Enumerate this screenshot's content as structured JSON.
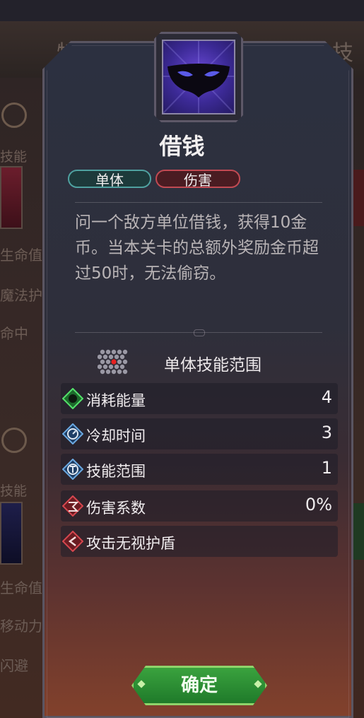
{
  "background": {
    "tabs": [
      "特厍",
      "技俞"
    ],
    "side_labels": [
      "技能",
      "生命值",
      "魔法护",
      "命中",
      "技能",
      "生命值",
      "移动力",
      "闪避"
    ]
  },
  "skill": {
    "name": "借钱",
    "icon": "mask-icon",
    "tags": [
      "单体",
      "伤害"
    ],
    "description": "问一个敌方单位借钱，获得10金币。当本关卡的总额外奖励金币超过50时，无法偷窃。",
    "range_label": "单体技能范围"
  },
  "stats": [
    {
      "icon": "energy-icon",
      "label": "消耗能量",
      "value": "4"
    },
    {
      "icon": "cooldown-icon",
      "label": "冷却时间",
      "value": "3"
    },
    {
      "icon": "range-icon",
      "label": "技能范围",
      "value": "1"
    },
    {
      "icon": "damage-icon",
      "label": "伤害系数",
      "value": "0%"
    },
    {
      "icon": "ignore-shield-icon",
      "label": "攻击无视护盾",
      "value": ""
    }
  ],
  "confirm_label": "确定",
  "colors": {
    "tag_single": "#4fa1a0",
    "tag_damage": "#c14a53",
    "confirm": "#2f9535"
  }
}
